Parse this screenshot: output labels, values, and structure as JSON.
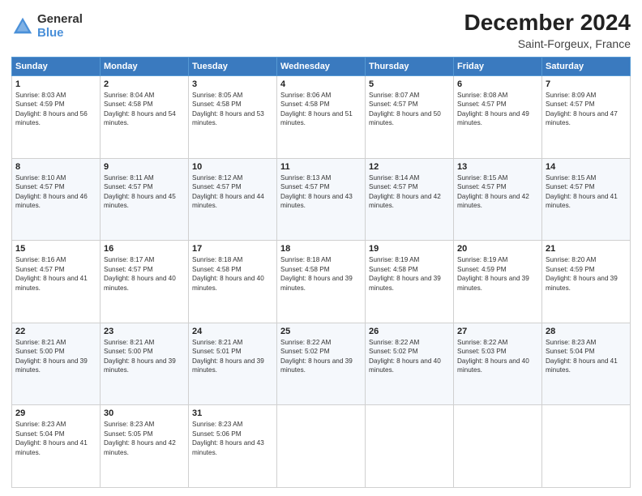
{
  "header": {
    "logo_general": "General",
    "logo_blue": "Blue",
    "title": "December 2024",
    "subtitle": "Saint-Forgeux, France"
  },
  "calendar": {
    "headers": [
      "Sunday",
      "Monday",
      "Tuesday",
      "Wednesday",
      "Thursday",
      "Friday",
      "Saturday"
    ],
    "weeks": [
      [
        {
          "day": "1",
          "sunrise": "8:03 AM",
          "sunset": "4:59 PM",
          "daylight": "8 hours and 56 minutes."
        },
        {
          "day": "2",
          "sunrise": "8:04 AM",
          "sunset": "4:58 PM",
          "daylight": "8 hours and 54 minutes."
        },
        {
          "day": "3",
          "sunrise": "8:05 AM",
          "sunset": "4:58 PM",
          "daylight": "8 hours and 53 minutes."
        },
        {
          "day": "4",
          "sunrise": "8:06 AM",
          "sunset": "4:58 PM",
          "daylight": "8 hours and 51 minutes."
        },
        {
          "day": "5",
          "sunrise": "8:07 AM",
          "sunset": "4:57 PM",
          "daylight": "8 hours and 50 minutes."
        },
        {
          "day": "6",
          "sunrise": "8:08 AM",
          "sunset": "4:57 PM",
          "daylight": "8 hours and 49 minutes."
        },
        {
          "day": "7",
          "sunrise": "8:09 AM",
          "sunset": "4:57 PM",
          "daylight": "8 hours and 47 minutes."
        }
      ],
      [
        {
          "day": "8",
          "sunrise": "8:10 AM",
          "sunset": "4:57 PM",
          "daylight": "8 hours and 46 minutes."
        },
        {
          "day": "9",
          "sunrise": "8:11 AM",
          "sunset": "4:57 PM",
          "daylight": "8 hours and 45 minutes."
        },
        {
          "day": "10",
          "sunrise": "8:12 AM",
          "sunset": "4:57 PM",
          "daylight": "8 hours and 44 minutes."
        },
        {
          "day": "11",
          "sunrise": "8:13 AM",
          "sunset": "4:57 PM",
          "daylight": "8 hours and 43 minutes."
        },
        {
          "day": "12",
          "sunrise": "8:14 AM",
          "sunset": "4:57 PM",
          "daylight": "8 hours and 42 minutes."
        },
        {
          "day": "13",
          "sunrise": "8:15 AM",
          "sunset": "4:57 PM",
          "daylight": "8 hours and 42 minutes."
        },
        {
          "day": "14",
          "sunrise": "8:15 AM",
          "sunset": "4:57 PM",
          "daylight": "8 hours and 41 minutes."
        }
      ],
      [
        {
          "day": "15",
          "sunrise": "8:16 AM",
          "sunset": "4:57 PM",
          "daylight": "8 hours and 41 minutes."
        },
        {
          "day": "16",
          "sunrise": "8:17 AM",
          "sunset": "4:57 PM",
          "daylight": "8 hours and 40 minutes."
        },
        {
          "day": "17",
          "sunrise": "8:18 AM",
          "sunset": "4:58 PM",
          "daylight": "8 hours and 40 minutes."
        },
        {
          "day": "18",
          "sunrise": "8:18 AM",
          "sunset": "4:58 PM",
          "daylight": "8 hours and 39 minutes."
        },
        {
          "day": "19",
          "sunrise": "8:19 AM",
          "sunset": "4:58 PM",
          "daylight": "8 hours and 39 minutes."
        },
        {
          "day": "20",
          "sunrise": "8:19 AM",
          "sunset": "4:59 PM",
          "daylight": "8 hours and 39 minutes."
        },
        {
          "day": "21",
          "sunrise": "8:20 AM",
          "sunset": "4:59 PM",
          "daylight": "8 hours and 39 minutes."
        }
      ],
      [
        {
          "day": "22",
          "sunrise": "8:21 AM",
          "sunset": "5:00 PM",
          "daylight": "8 hours and 39 minutes."
        },
        {
          "day": "23",
          "sunrise": "8:21 AM",
          "sunset": "5:00 PM",
          "daylight": "8 hours and 39 minutes."
        },
        {
          "day": "24",
          "sunrise": "8:21 AM",
          "sunset": "5:01 PM",
          "daylight": "8 hours and 39 minutes."
        },
        {
          "day": "25",
          "sunrise": "8:22 AM",
          "sunset": "5:02 PM",
          "daylight": "8 hours and 39 minutes."
        },
        {
          "day": "26",
          "sunrise": "8:22 AM",
          "sunset": "5:02 PM",
          "daylight": "8 hours and 40 minutes."
        },
        {
          "day": "27",
          "sunrise": "8:22 AM",
          "sunset": "5:03 PM",
          "daylight": "8 hours and 40 minutes."
        },
        {
          "day": "28",
          "sunrise": "8:23 AM",
          "sunset": "5:04 PM",
          "daylight": "8 hours and 41 minutes."
        }
      ],
      [
        {
          "day": "29",
          "sunrise": "8:23 AM",
          "sunset": "5:04 PM",
          "daylight": "8 hours and 41 minutes."
        },
        {
          "day": "30",
          "sunrise": "8:23 AM",
          "sunset": "5:05 PM",
          "daylight": "8 hours and 42 minutes."
        },
        {
          "day": "31",
          "sunrise": "8:23 AM",
          "sunset": "5:06 PM",
          "daylight": "8 hours and 43 minutes."
        },
        null,
        null,
        null,
        null
      ]
    ]
  }
}
